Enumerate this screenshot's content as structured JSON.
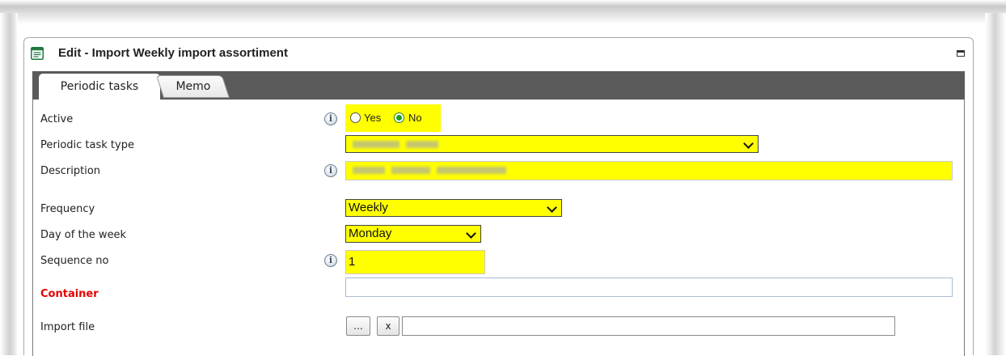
{
  "window": {
    "title": "Edit - Import Weekly import assortiment"
  },
  "tabs": [
    {
      "label": "Periodic tasks",
      "active": true
    },
    {
      "label": "Memo",
      "active": false
    }
  ],
  "form": {
    "active": {
      "label": "Active",
      "options": [
        "Yes",
        "No"
      ],
      "selected": "No"
    },
    "task_type": {
      "label": "Periodic task type",
      "value": ""
    },
    "description": {
      "label": "Description",
      "value": ""
    },
    "frequency": {
      "label": "Frequency",
      "value": "Weekly"
    },
    "day_of_week": {
      "label": "Day of the week",
      "value": "Monday"
    },
    "sequence_no": {
      "label": "Sequence no",
      "value": "1"
    },
    "container": {
      "label": "Container",
      "value": ""
    },
    "import_file": {
      "label": "Import file",
      "browse_label": "...",
      "clear_label": "x",
      "value": ""
    }
  },
  "icons": {
    "window_icon": "form-document-icon",
    "info_icon": "info-icon",
    "maximize_icon": "maximize-icon"
  },
  "colors": {
    "highlight": "#ffff00",
    "required_label": "#e60000",
    "tabbar": "#5a5a5a"
  }
}
